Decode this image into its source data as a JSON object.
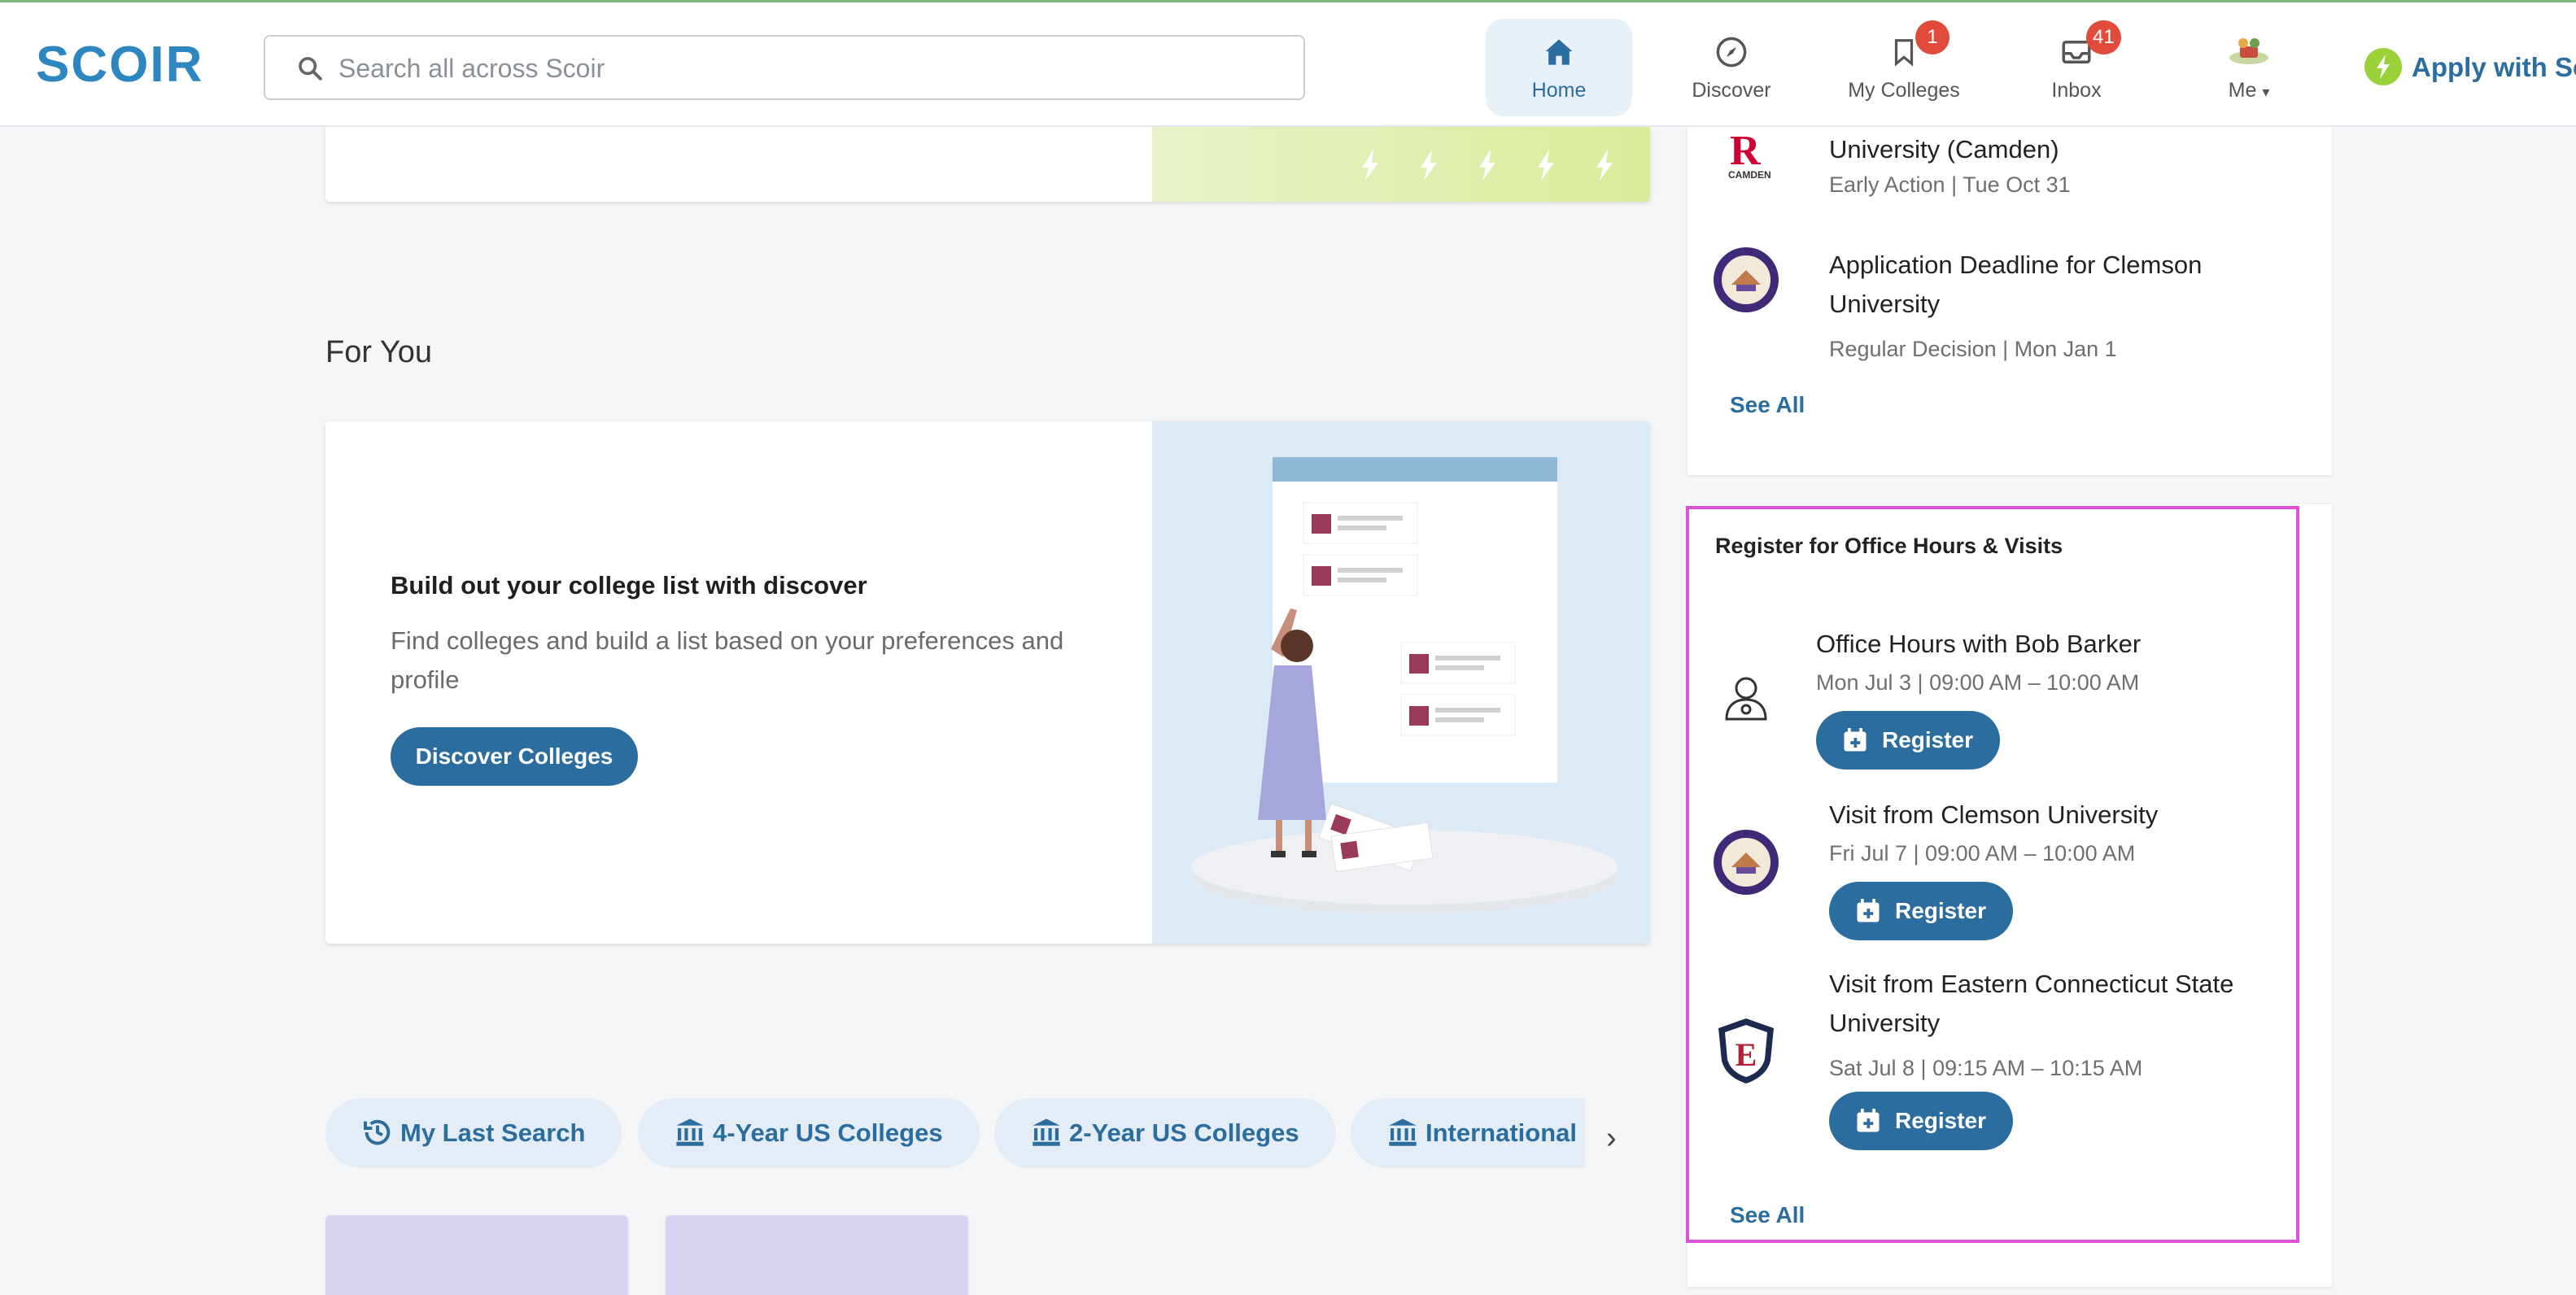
{
  "app": {
    "logo_text": "SCOIR",
    "brand_color": "#2e86c1",
    "accent_color": "#2b6d9e",
    "badge_color": "#e14b3b",
    "highlight_color": "#e050d6"
  },
  "search": {
    "placeholder": "Search all across Scoir"
  },
  "nav": {
    "items": [
      {
        "label": "Home",
        "icon": "home-icon",
        "active": true
      },
      {
        "label": "Discover",
        "icon": "compass-icon"
      },
      {
        "label": "My Colleges",
        "icon": "bookmark-icon",
        "badge": "1"
      },
      {
        "label": "Inbox",
        "icon": "inbox-icon",
        "badge": "41"
      },
      {
        "label": "Me",
        "icon": "avatar-icon"
      }
    ],
    "apply_label": "Apply with Scoir"
  },
  "for_you": {
    "section_title": "For You",
    "card": {
      "heading": "Build out your college list with discover",
      "description": "Find colleges and build a list based on your preferences and profile",
      "button_label": "Discover Colleges"
    }
  },
  "chips": [
    {
      "label": "My Last Search",
      "icon": "history-icon"
    },
    {
      "label": "4-Year US Colleges",
      "icon": "institution-icon"
    },
    {
      "label": "2-Year US Colleges",
      "icon": "institution-icon"
    },
    {
      "label": "International",
      "icon": "institution-icon"
    }
  ],
  "deadlines": {
    "items": [
      {
        "title": "University (Camden)",
        "sub": "Early Action | Tue Oct 31",
        "logo": "rutgers-camden-logo",
        "logo_text": "R",
        "logo_caption": "CAMDEN"
      },
      {
        "title_line1": "Application Deadline for Clemson",
        "title_line2": "University",
        "sub": "Regular Decision | Mon Jan 1",
        "logo": "clemson-seal-logo"
      }
    ],
    "see_all": "See All"
  },
  "visits": {
    "title": "Register for Office Hours & Visits",
    "items": [
      {
        "title": "Office Hours with Bob Barker",
        "sub": "Mon Jul 3 | 09:00 AM – 10:00 AM",
        "button": "Register",
        "logo": "person-icon"
      },
      {
        "title": "Visit from Clemson University",
        "sub": "Fri Jul 7 | 09:00 AM – 10:00 AM",
        "button": "Register",
        "logo": "clemson-seal-logo"
      },
      {
        "title_line1": "Visit from Eastern Connecticut State",
        "title_line2": "University",
        "sub": "Sat Jul 8 | 09:15 AM – 10:15 AM",
        "button": "Register",
        "logo": "eastern-ct-shield-logo",
        "logo_text": "E"
      }
    ],
    "see_all": "See All"
  }
}
